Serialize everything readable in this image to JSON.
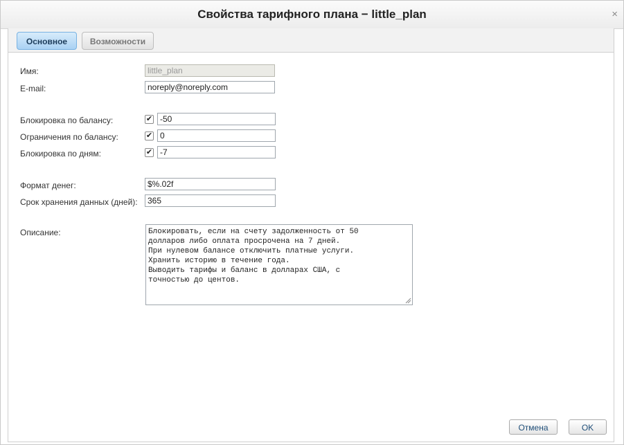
{
  "dialog": {
    "title": "Свойства тарифного плана − little_plan",
    "close_icon": "×"
  },
  "tabs": [
    {
      "label": "Основное",
      "active": true
    },
    {
      "label": "Возможности",
      "active": false
    }
  ],
  "form": {
    "name": {
      "label": "Имя:",
      "value": "little_plan",
      "disabled": true
    },
    "email": {
      "label": "E-mail:",
      "value": "noreply@noreply.com"
    },
    "balance_block": {
      "label": "Блокировка по балансу:",
      "checked": true,
      "value": "-50"
    },
    "balance_limit": {
      "label": "Ограничения по балансу:",
      "checked": true,
      "value": "0"
    },
    "days_block": {
      "label": "Блокировка по дням:",
      "checked": true,
      "value": "-7"
    },
    "money_format": {
      "label": "Формат денег:",
      "value": "$%.02f"
    },
    "retention": {
      "label": "Срок хранения данных (дней):",
      "value": "365"
    },
    "description": {
      "label": "Описание:",
      "value": "Блокировать, если на счету задолженность от 50\nдолларов либо оплата просрочена на 7 дней.\nПри нулевом балансе отключить платные услуги.\nХранить историю в течение года.\nВыводить тарифы и баланс в долларах США, с\nточностью до центов."
    }
  },
  "buttons": {
    "cancel": "Отмена",
    "ok": "OK"
  },
  "icons": {
    "check": "✔",
    "close": "close-icon",
    "resize": "resize-grip-icon"
  },
  "colors": {
    "active_tab": "#a9d1f3",
    "input_border": "#9fa6ad",
    "button_text": "#1f4e79"
  }
}
